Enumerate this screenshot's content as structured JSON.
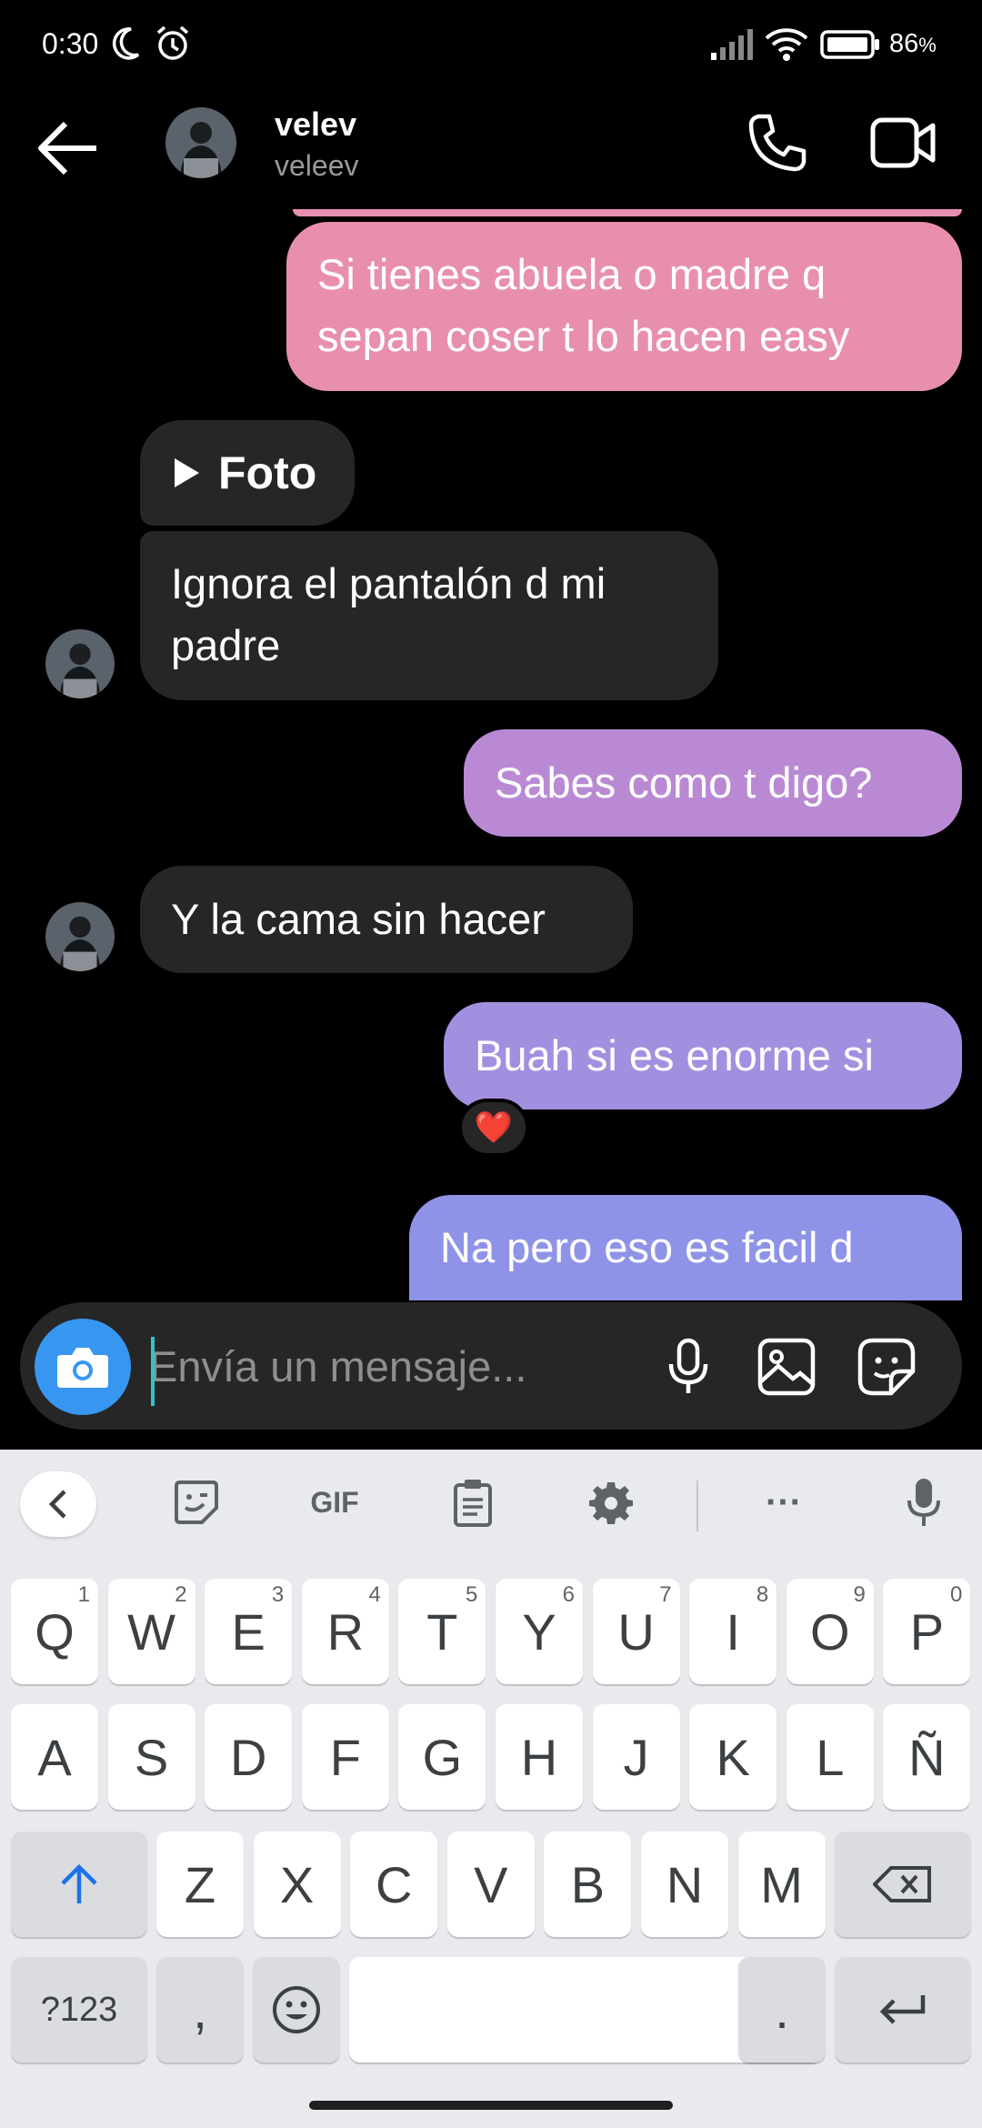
{
  "status_bar": {
    "time": "0:30",
    "battery_percent": "86",
    "battery_symbol": "%",
    "icons": [
      "moon-icon",
      "alarm-icon",
      "signal-icon",
      "wifi-icon",
      "battery-icon"
    ]
  },
  "header": {
    "name": "velev",
    "username": "veleev"
  },
  "messages": [
    {
      "direction": "out",
      "text_line1": "Si tienes abuela o madre q",
      "text_line2": "sepan coser t lo hacen easy",
      "color": "#e88fb0"
    },
    {
      "direction": "in",
      "type": "photo",
      "label": "Foto"
    },
    {
      "direction": "in",
      "text_line1": "Ignora el pantalón d mi",
      "text_line2": "padre"
    },
    {
      "direction": "out",
      "text": "Sabes como t digo?",
      "color": "#b98ad3"
    },
    {
      "direction": "in",
      "text": "Y la cama sin hacer"
    },
    {
      "direction": "out",
      "text": "Buah si es enorme si",
      "color": "#a38fe0",
      "reaction": "❤️"
    },
    {
      "direction": "out",
      "text": "Na pero eso es facil d",
      "color": "#8f93e8"
    }
  ],
  "composer": {
    "placeholder": "Envía un mensaje...",
    "value": ""
  },
  "keyboard": {
    "toolbar": [
      "collapse-icon",
      "sticker-icon",
      "GIF",
      "clipboard-icon",
      "settings-icon",
      "more-icon",
      "voice-icon"
    ],
    "gif_label": "GIF",
    "more_label": "···",
    "row1": [
      [
        "Q",
        "1"
      ],
      [
        "W",
        "2"
      ],
      [
        "E",
        "3"
      ],
      [
        "R",
        "4"
      ],
      [
        "T",
        "5"
      ],
      [
        "Y",
        "6"
      ],
      [
        "U",
        "7"
      ],
      [
        "I",
        "8"
      ],
      [
        "O",
        "9"
      ],
      [
        "P",
        "0"
      ]
    ],
    "row2": [
      "A",
      "S",
      "D",
      "F",
      "G",
      "H",
      "J",
      "K",
      "L",
      "Ñ"
    ],
    "row3": [
      "Z",
      "X",
      "C",
      "V",
      "B",
      "N",
      "M"
    ],
    "symbols_label": "?123",
    "comma": ",",
    "period": ".",
    "colors": {
      "accent": "#3797f0",
      "shift": "#1a73e8",
      "keyboard_bg": "#e8eaed"
    }
  }
}
